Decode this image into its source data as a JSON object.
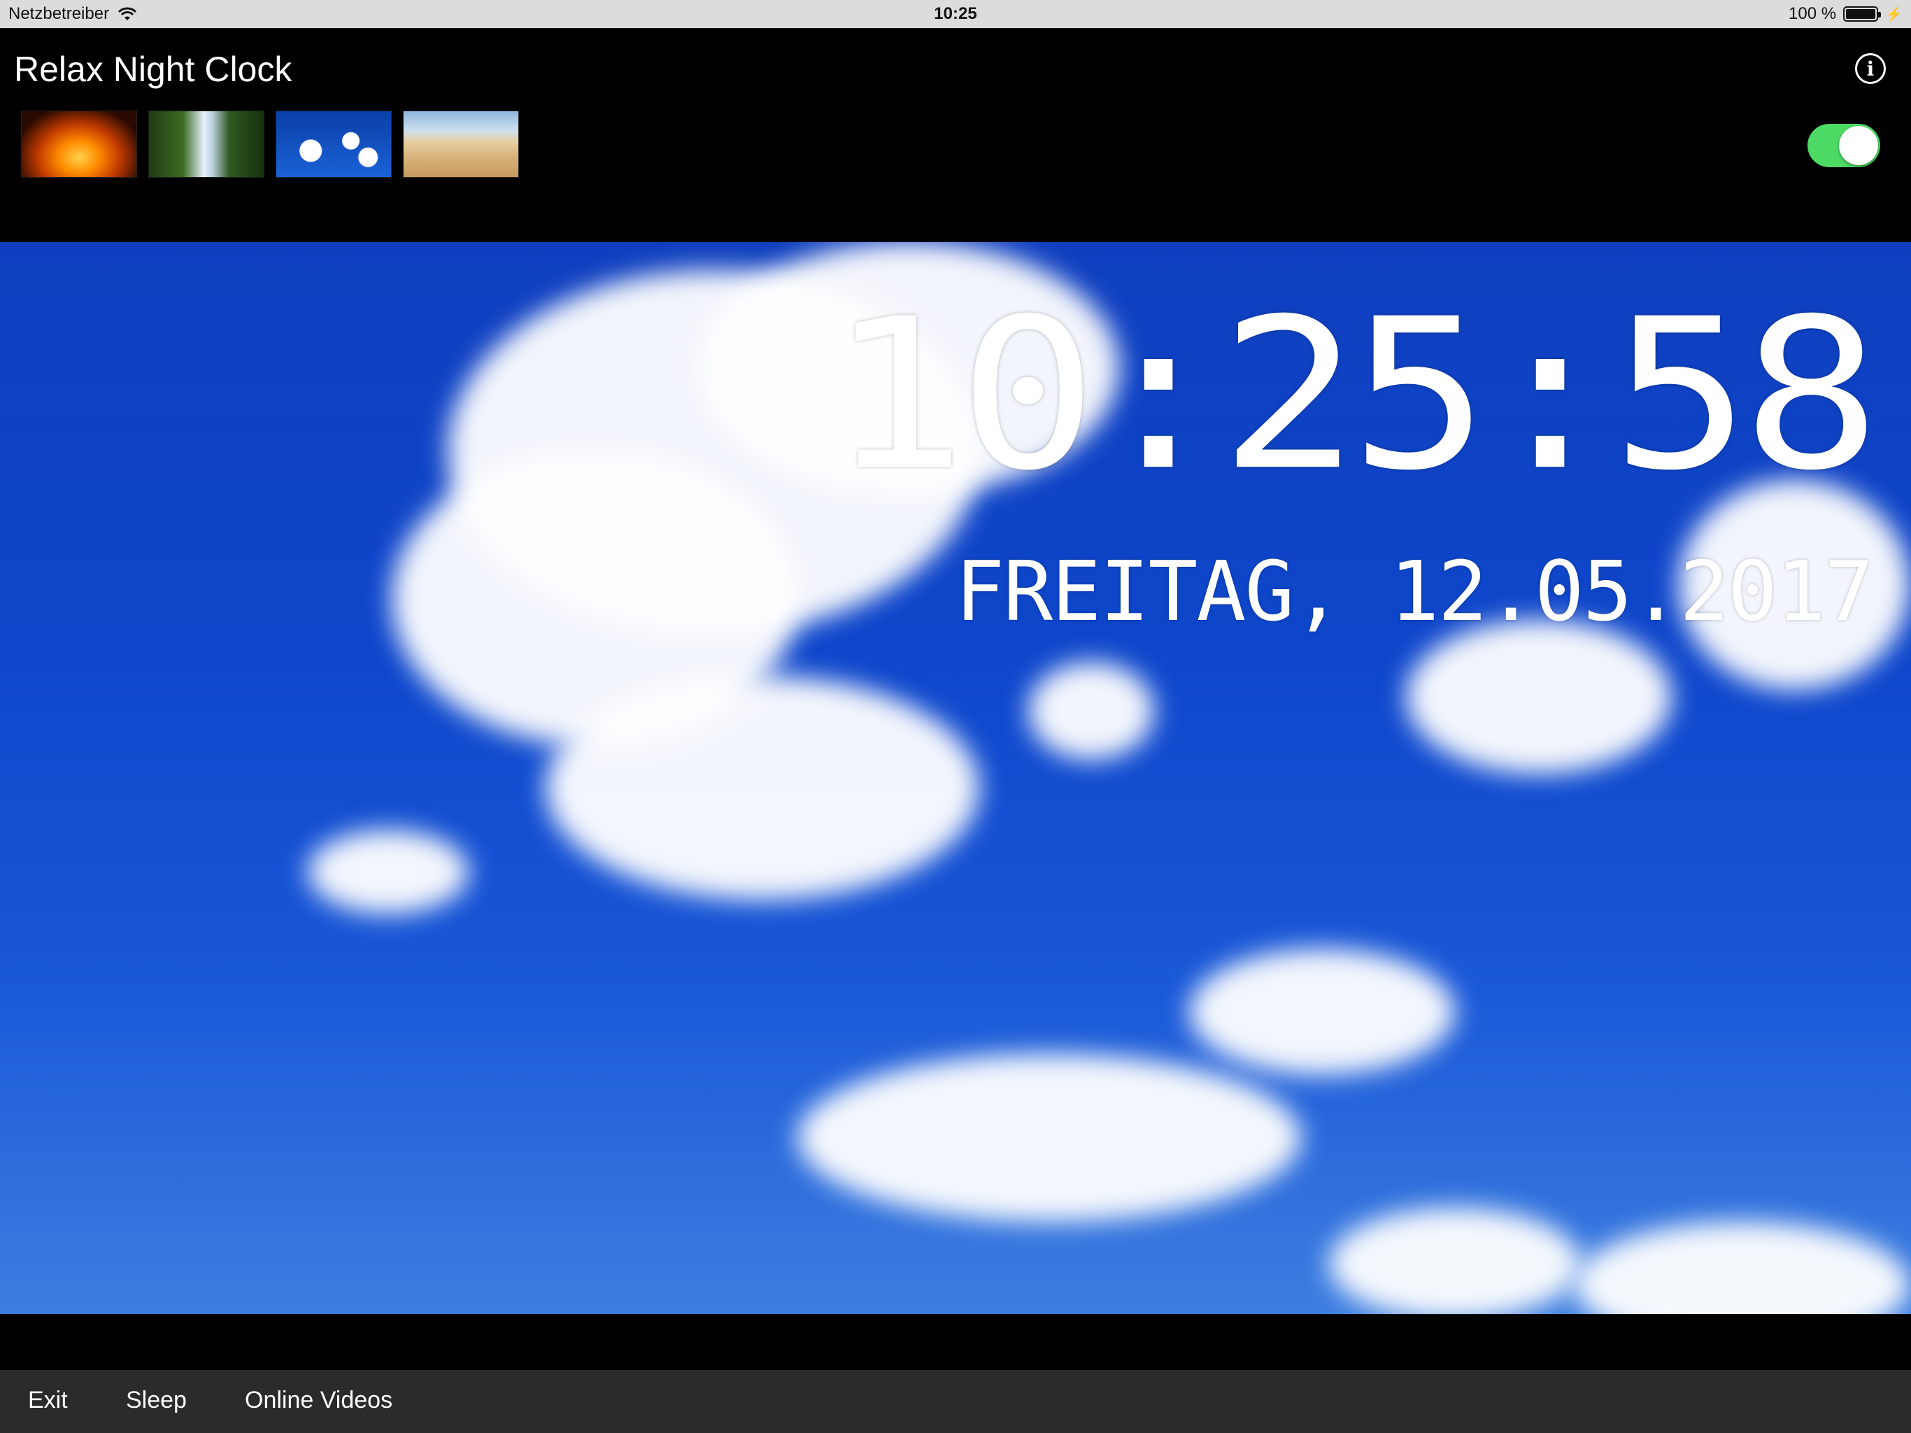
{
  "status_bar": {
    "carrier": "Netzbetreiber",
    "time": "10:25",
    "battery": "100 %"
  },
  "header": {
    "title": "Relax Night Clock",
    "info_icon": "info-icon"
  },
  "thumbnails": [
    {
      "name": "thumb-fire"
    },
    {
      "name": "thumb-waterfall"
    },
    {
      "name": "thumb-sky"
    },
    {
      "name": "thumb-desert"
    }
  ],
  "toggle": {
    "on": true,
    "color": "#4cd964"
  },
  "clock": {
    "time": "10:25:58",
    "date": "FREITAG, 12.05.2017"
  },
  "bottom_bar": {
    "exit": "Exit",
    "sleep": "Sleep",
    "online_videos": "Online Videos"
  }
}
